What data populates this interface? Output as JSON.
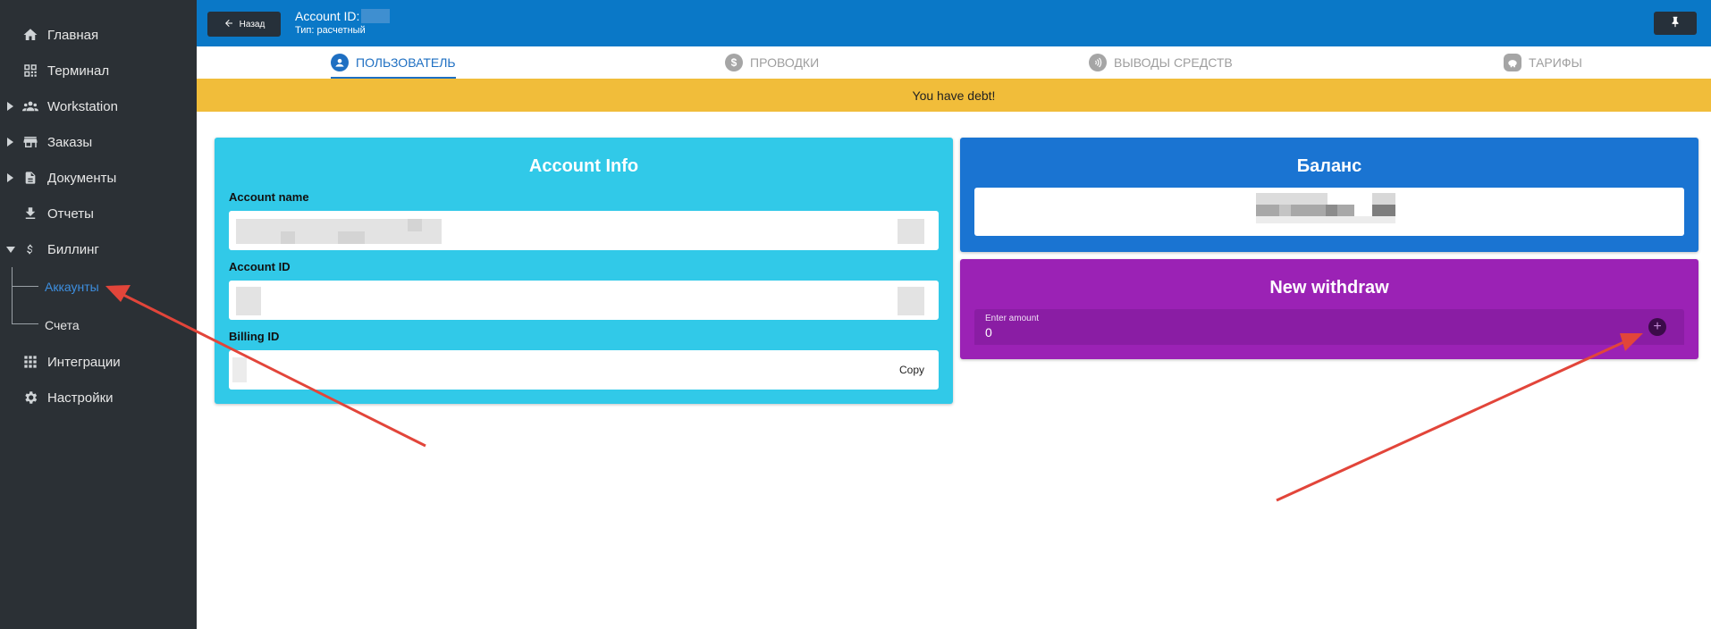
{
  "sidebar": {
    "items": [
      {
        "label": "Главная",
        "icon": "home-icon"
      },
      {
        "label": "Терминал",
        "icon": "qr-code-icon"
      },
      {
        "label": "Workstation",
        "icon": "people-icon"
      },
      {
        "label": "Заказы",
        "icon": "store-icon"
      },
      {
        "label": "Документы",
        "icon": "document-icon"
      },
      {
        "label": "Отчеты",
        "icon": "download-icon"
      },
      {
        "label": "Биллинг",
        "icon": "dollar-icon"
      },
      {
        "label": "Интеграции",
        "icon": "apps-grid-icon"
      },
      {
        "label": "Настройки",
        "icon": "gear-icon"
      }
    ],
    "billing_sub": [
      {
        "label": "Аккаунты",
        "active": true
      },
      {
        "label": "Счета",
        "active": false
      }
    ],
    "active_color": "#3d8fe0"
  },
  "header": {
    "back_label": "Назад",
    "title": "Account ID:",
    "subtitle": "Тип: расчетный",
    "pin_icon": "pin-icon",
    "color": "#0a78c7"
  },
  "tabs": [
    {
      "label": "ПОЛЬЗОВАТЕЛЬ",
      "icon": "account-circle-icon",
      "active": true
    },
    {
      "label": "ПРОВОДКИ",
      "icon": "dollar-circle-icon",
      "active": false
    },
    {
      "label": "ВЫВОДЫ СРЕДСТВ",
      "icon": "nfc-icon",
      "active": false
    },
    {
      "label": "ТАРИФЫ",
      "icon": "piggy-bank-icon",
      "active": false
    }
  ],
  "banner": {
    "text": "You have debt!",
    "color": "#f1bd3a"
  },
  "account_info": {
    "title": "Account Info",
    "color": "#31c9e8",
    "fields": [
      {
        "label": "Account name"
      },
      {
        "label": "Account ID"
      },
      {
        "label": "Billing ID",
        "action": "Copy"
      }
    ]
  },
  "balance": {
    "title": "Баланс",
    "color": "#1a74d2"
  },
  "withdraw": {
    "title": "New withdraw",
    "color": "#9b22b5",
    "amount_label": "Enter amount",
    "amount_value": "0",
    "add_icon": "plus-circle-icon"
  },
  "annotation_color": "#e2453a"
}
